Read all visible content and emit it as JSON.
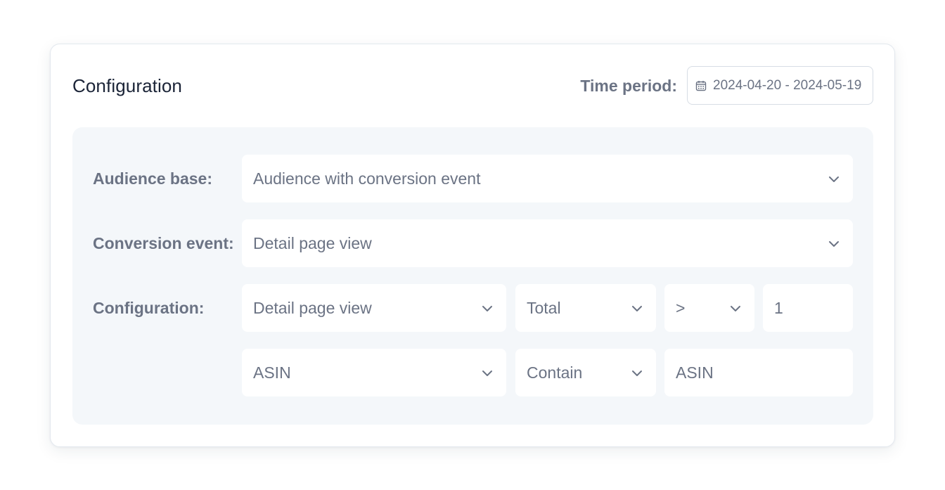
{
  "header": {
    "title": "Configuration",
    "time_period_label": "Time period:",
    "date_range": "2024-04-20 - 2024-05-19"
  },
  "audience_base": {
    "label": "Audience base:",
    "value": "Audience with conversion event"
  },
  "conversion_event": {
    "label": "Conversion event:",
    "value": "Detail page view"
  },
  "configuration": {
    "label": "Configuration:",
    "row1": {
      "event": "Detail page view",
      "aggregation": "Total",
      "operator": ">",
      "threshold": "1"
    },
    "row2": {
      "attribute": "ASIN",
      "match": "Contain",
      "value_placeholder": "ASIN"
    }
  },
  "icons": {
    "date": "calendar-icon",
    "dropdown": "chevron-down-icon"
  },
  "colors": {
    "title_text": "#1b2437",
    "muted_text": "#6b7384",
    "panel_bg": "#f4f7fa",
    "border": "#d7dde5"
  }
}
